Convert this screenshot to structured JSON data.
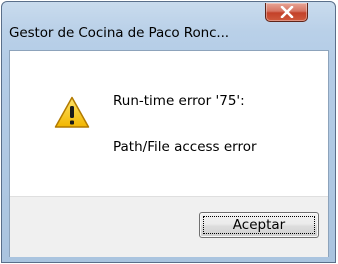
{
  "window": {
    "title": "Gestor de Cocina de Paco Ronc..."
  },
  "dialog": {
    "icon": "warning-icon",
    "message_line1": "Run-time error '75':",
    "message_line2": "Path/File access error"
  },
  "buttons": {
    "ok_label": "Aceptar"
  },
  "colors": {
    "close_button": "#c9472e",
    "title_bar": "#b9d0e8",
    "button_bar": "#f0f0f0",
    "warning_fill": "#f5c400"
  }
}
